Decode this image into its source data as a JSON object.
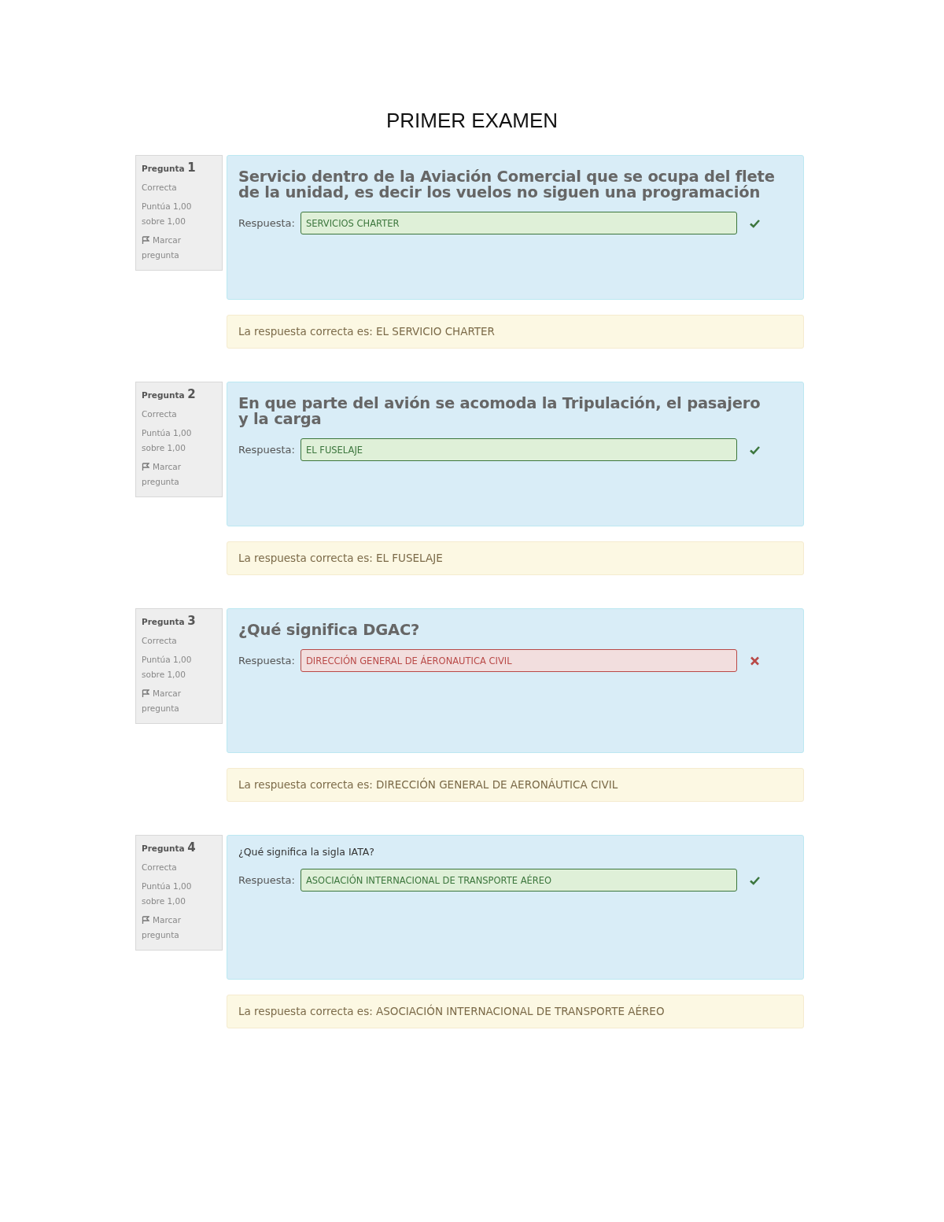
{
  "title": "PRIMER EXAMEN",
  "questions": [
    {
      "kind": "heading",
      "label": "Pregunta",
      "number": "1",
      "status": "Correcta",
      "score": "Puntúa 1,00 sobre 1,00",
      "flag_label": "Marcar pregunta",
      "text_lines": [
        "Servicio dentro de la **Aviación Comercial** que se ocupa del flete",
        "de la unidad, es decir los vuelos no siguen una programación"
      ],
      "answer_label": "Respuesta:",
      "answer": "SERVICIOS CHARTER",
      "correct": true,
      "feedback": "La respuesta correcta es: EL SERVICIO CHARTER"
    },
    {
      "kind": "heading",
      "label": "Pregunta",
      "number": "2",
      "status": "Correcta",
      "score": "Puntúa 1,00 sobre 1,00",
      "flag_label": "Marcar pregunta",
      "text_lines": [
        "En que parte del avión se acomoda la Tripulación, el pasajero",
        "y la carga"
      ],
      "answer_label": "Respuesta:",
      "answer": "EL FUSELAJE",
      "correct": true,
      "feedback": "La respuesta correcta es: EL FUSELAJE"
    },
    {
      "kind": "heading",
      "label": "Pregunta",
      "number": "3",
      "status": "Correcta",
      "score": "Puntúa 1,00 sobre 1,00",
      "flag_label": "Marcar pregunta",
      "text_lines": [
        "¿Qué significa DGAC?"
      ],
      "answer_label": "Respuesta:",
      "answer": "DIRECCIÓN GENERAL DE ÁERONAUTICA CIVIL",
      "correct": false,
      "feedback": "La respuesta correcta es: DIRECCIÓN GENERAL DE AERONÁUTICA CIVIL"
    },
    {
      "kind": "plain",
      "label": "Pregunta",
      "number": "4",
      "status": "Correcta",
      "score": "Puntúa 1,00 sobre 1,00",
      "flag_label": "Marcar pregunta",
      "text_lines": [
        "¿Qué significa la sigla IATA?"
      ],
      "answer_label": "Respuesta:",
      "answer": "ASOCIACIÓN INTERNACIONAL DE TRANSPORTE AÉREO",
      "correct": true,
      "feedback": "La respuesta correcta es: ASOCIACIÓN INTERNACIONAL DE TRANSPORTE AÉREO"
    }
  ]
}
